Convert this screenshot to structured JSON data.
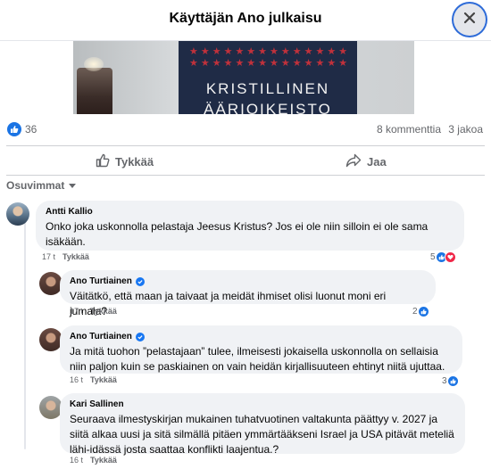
{
  "header": {
    "title": "Käyttäjän Ano julkaisu"
  },
  "post_image": {
    "book_title_line1": "KRISTILLINEN",
    "book_title_line2": "ÄÄRIOIKEISTO"
  },
  "stats": {
    "likes": "36",
    "comments": "8 kommenttia",
    "shares": "3 jakoa"
  },
  "actions": {
    "like_label": "Tykkää",
    "share_label": "Jaa"
  },
  "comments_sort": {
    "label": "Osuvimmat"
  },
  "comments": [
    {
      "author": "Antti Kallio",
      "verified": false,
      "text": "Onko joka uskonnolla pelastaja Jeesus Kristus? Jos ei ole niin silloin ei ole sama\nisäkään.",
      "time": "17 t",
      "like_label": "Tykkää",
      "reactions": "5"
    },
    {
      "author": "Ano Turtiainen",
      "verified": true,
      "text": "Väitätkö, että maan ja taivaat ja meidät ihmiset olisi luonut moni eri jumala?",
      "time": "17 t",
      "like_label": "Tykkää",
      "reactions": "2"
    },
    {
      "author": "Ano Turtiainen",
      "verified": true,
      "text": "Ja mitä tuohon ”pelastajaan” tulee, ilmeisesti jokaisella uskonnolla on sellaisia\nniin paljon kuin se paskiainen on vain heidän kirjallisuuteen ehtinyt niitä ujuttaa.",
      "time": "16 t",
      "like_label": "Tykkää",
      "reactions": "3"
    },
    {
      "author": "Kari Sallinen",
      "verified": false,
      "text": "Seuraava ilmestyskirjan mukainen tuhatvuotinen valtakunta päättyy v. 2027 ja\nsiitä alkaa uusi ja sitä silmällä pitäen ymmärtääkseni Israel ja USA pitävät meteliä\nlähi-idässä josta saattaa konflikti laajentua.?",
      "time": "16 t",
      "like_label": "Tykkää",
      "reactions": ""
    }
  ],
  "colors": {
    "accent": "#1b74e4",
    "bubble": "#f0f2f5",
    "secondary_text": "#65676b",
    "love": "#f02849"
  }
}
